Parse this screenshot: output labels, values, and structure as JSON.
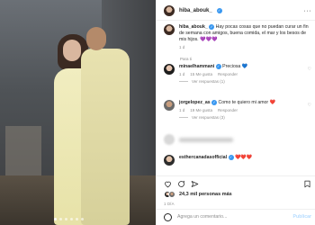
{
  "post": {
    "username": "hiba_abouk_",
    "more": "···",
    "caption": "Hay pocas cosas que no puedan curar un fin de semana con amigos, buena comida, el mar y los besos de mis hijos. 💜💜💜",
    "caption_time": "1 d",
    "translation_label": "Para ti"
  },
  "comments": [
    {
      "username": "minaelhammani",
      "text": "Preciosa 💙",
      "time": "1 d",
      "likes": "15 Me gusta",
      "reply": "Responder",
      "view_replies": "Ver respuestas (1)"
    },
    {
      "username": "jorgelopez_as",
      "text": "Como te quiero mi amor ❤️",
      "time": "1 d",
      "likes": "19 Me gusta",
      "reply": "Responder",
      "view_replies": "Ver respuestas (3)"
    },
    {
      "username": "esthercanadasofficial",
      "text": "❤️❤️❤️",
      "time": "",
      "likes": "",
      "reply": "",
      "view_replies": ""
    }
  ],
  "actions": {
    "likes_text": "24,3 mil personas más",
    "date": "1 DÍA"
  },
  "add_comment": {
    "placeholder": "Agrega un comentario...",
    "publish_label": "Publicar"
  },
  "colors": {
    "verified": "#3897f0",
    "like_red": "#ed4956",
    "link_disabled": "#b3dbff"
  }
}
